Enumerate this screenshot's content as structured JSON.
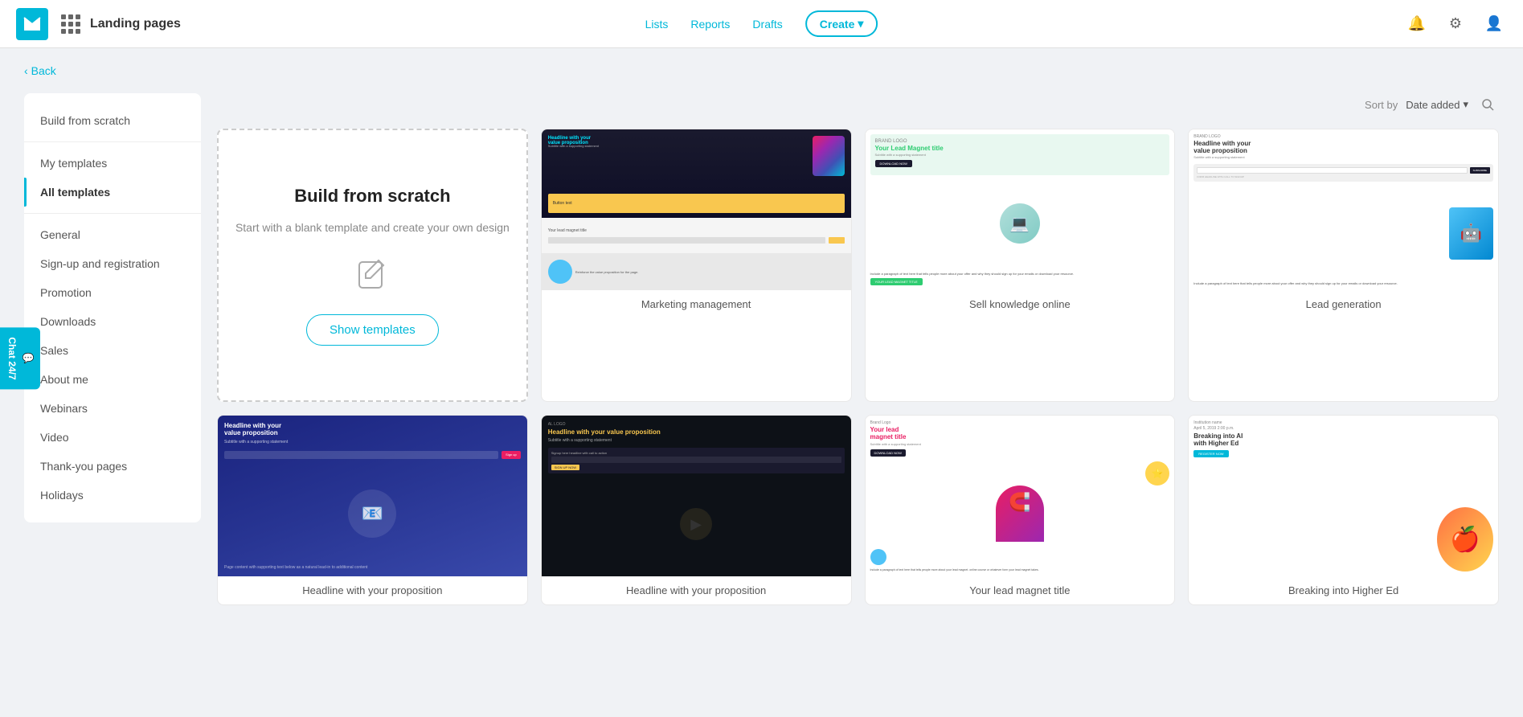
{
  "header": {
    "title": "Landing pages",
    "nav": [
      {
        "id": "lists",
        "label": "Lists",
        "active": false
      },
      {
        "id": "reports",
        "label": "Reports",
        "active": false
      },
      {
        "id": "drafts",
        "label": "Drafts",
        "active": false
      }
    ],
    "create_label": "Create",
    "logo_alt": "Email logo"
  },
  "back_link": "Back",
  "sort": {
    "label": "Sort by",
    "value": "Date added",
    "arrow": "↓"
  },
  "sidebar": {
    "build_from_scratch": "Build from scratch",
    "my_templates": "My templates",
    "all_templates": "All templates",
    "categories": [
      {
        "id": "general",
        "label": "General"
      },
      {
        "id": "sign-up",
        "label": "Sign-up and registration"
      },
      {
        "id": "promotion",
        "label": "Promotion"
      },
      {
        "id": "downloads",
        "label": "Downloads"
      },
      {
        "id": "sales",
        "label": "Sales"
      },
      {
        "id": "about-me",
        "label": "About me"
      },
      {
        "id": "webinars",
        "label": "Webinars"
      },
      {
        "id": "video",
        "label": "Video"
      },
      {
        "id": "thank-you",
        "label": "Thank-you pages"
      },
      {
        "id": "holidays",
        "label": "Holidays"
      }
    ]
  },
  "scratch_card": {
    "title": "Build from scratch",
    "description": "Start with a blank template and create your own design",
    "button_label": "Show templates"
  },
  "templates": [
    {
      "id": "marketing-management",
      "label": "Marketing management",
      "type": "marketing"
    },
    {
      "id": "sell-knowledge",
      "label": "Sell knowledge online",
      "type": "sell"
    },
    {
      "id": "lead-generation",
      "label": "Lead generation",
      "type": "lead-gen"
    },
    {
      "id": "headline-proposition",
      "label": "Headline with your proposition",
      "type": "dark-blue"
    },
    {
      "id": "dark-panel",
      "label": "Headline with your value proposition",
      "type": "dark-panel"
    },
    {
      "id": "lead-magnet",
      "label": "Your lead magnet title",
      "type": "magnet"
    },
    {
      "id": "breaking-higher",
      "label": "Breaking into AI with Higher Ed",
      "type": "breaking"
    }
  ],
  "chat_widget": {
    "label": "Chat 24/7"
  }
}
